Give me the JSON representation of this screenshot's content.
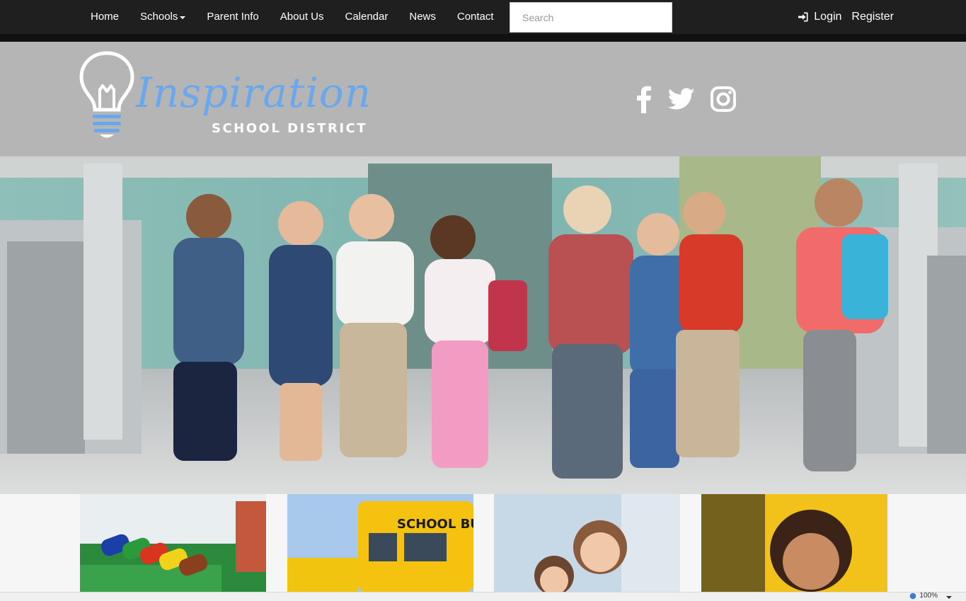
{
  "nav": {
    "items": [
      {
        "label": "Home"
      },
      {
        "label": "Schools",
        "dropdown": true
      },
      {
        "label": "Parent Info"
      },
      {
        "label": "About Us"
      },
      {
        "label": "Calendar"
      },
      {
        "label": "News"
      },
      {
        "label": "Contact"
      }
    ],
    "search_placeholder": "Search",
    "login_label": "Login",
    "register_label": "Register",
    "login_icon": "sign-in-icon"
  },
  "header": {
    "logo_script": "Inspiration",
    "logo_sub": "SCHOOL DISTRICT",
    "social": [
      "facebook-icon",
      "twitter-icon",
      "instagram-icon"
    ]
  },
  "statusbar": {
    "zoom": "100%"
  },
  "colors": {
    "nav_bg": "#1f1f1f",
    "header_bg": "#b5b5b5",
    "logo_blue": "#6aa8ee"
  }
}
